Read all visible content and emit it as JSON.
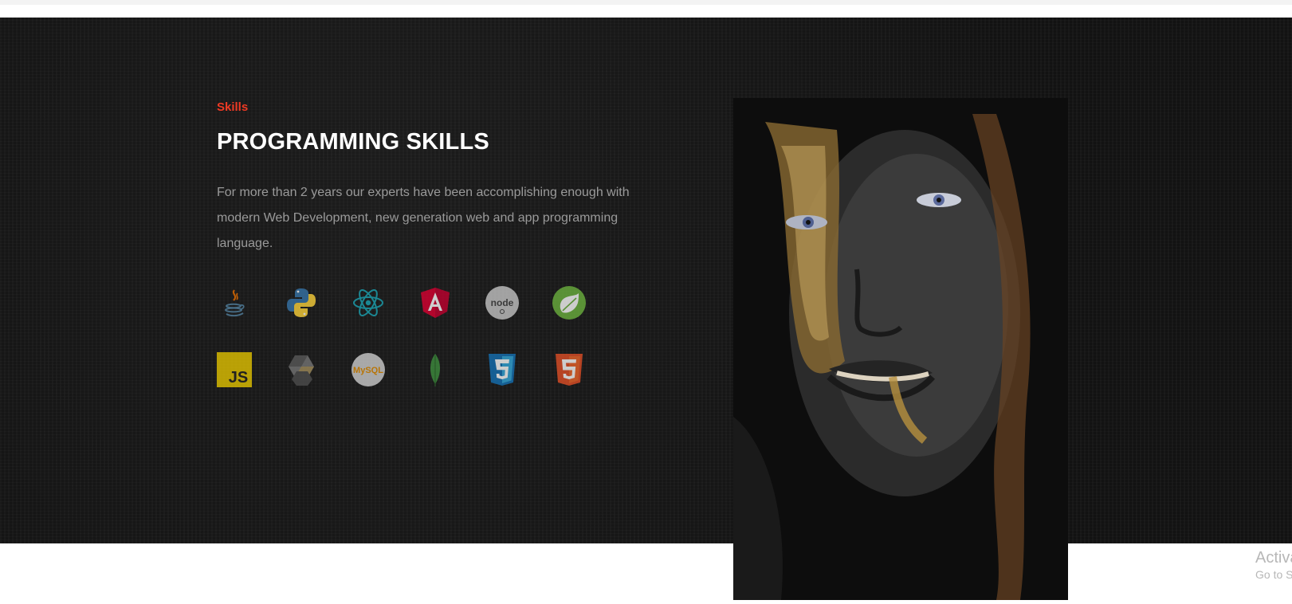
{
  "section": {
    "eyebrow": "Skills",
    "heading": "PROGRAMMING SKILLS",
    "description": "For more than 2 years our experts have been accomplishing enough with modern Web Development, new generation web and app programming language.",
    "accent_color": "#ee3a24",
    "background_color": "#141414"
  },
  "skill_icons": {
    "row1": [
      "java-icon",
      "python-icon",
      "react-icon",
      "angular-icon",
      "nodejs-icon",
      "spring-icon"
    ],
    "row2": [
      "javascript-icon",
      "hexagon-logo-icon",
      "mysql-icon",
      "mongodb-leaf-icon",
      "css3-icon",
      "html5-icon"
    ],
    "js_label": "JS",
    "mysql_label": "MySQL"
  },
  "photo": {
    "subject": "portrait-image"
  },
  "watermark": {
    "title": "Activa",
    "subtitle": "Go to S"
  }
}
